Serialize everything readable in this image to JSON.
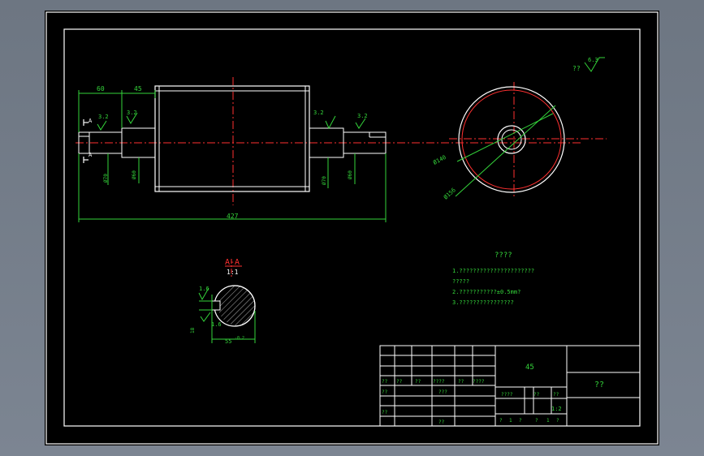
{
  "drawing": {
    "dimensions": {
      "d60": "60",
      "d45": "45",
      "d427": "427",
      "r32a": "3.2",
      "r32b": "3.2",
      "r32c": "3.2",
      "r32d": "3.2",
      "r16a": "1.6",
      "r16b": "1.6",
      "section_A_top": "A",
      "section_A_bottom": "A",
      "dia_left": "Ø70",
      "dia_left2": "Ø60",
      "dia_right": "Ø70",
      "dia_right2": "Ø60",
      "d140": "Ø140",
      "d156": "Ø156",
      "keyway_depth": "55",
      "keyway_tol": "-0.2",
      "keyway_width": "18",
      "corner_note": "??",
      "corner_rough": "6.3"
    },
    "section": {
      "label": "A-A",
      "scale": "1:1"
    },
    "notes": {
      "title": "????",
      "lines": [
        "1.??????????????????????",
        "?????",
        "2.???????????±0.5mm?",
        "3.????????????????"
      ]
    },
    "title_block": {
      "material": "45",
      "part_name": "??",
      "scale": "1:2",
      "row_labels": [
        "??",
        "??",
        "??",
        "????",
        "??",
        "????"
      ],
      "row2_label": "??",
      "row2_mid": "???",
      "row3_label": "??",
      "row3_mid": "??",
      "stage_label": "????",
      "weight_label": "??",
      "scale_label": "??",
      "sheet_info": [
        "?",
        "1",
        "?",
        "?",
        "1",
        "?"
      ]
    }
  }
}
